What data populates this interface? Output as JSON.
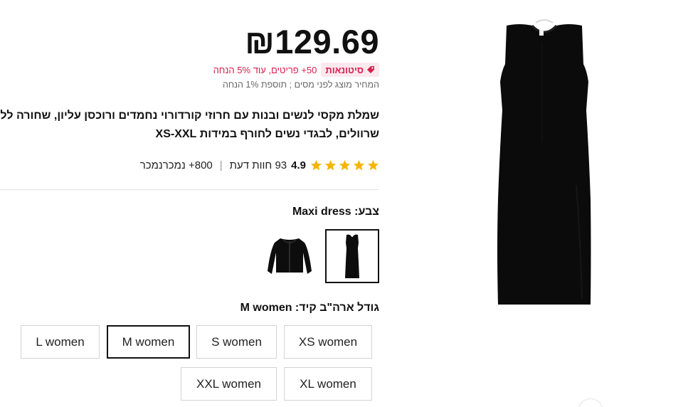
{
  "product": {
    "price": "₪129.69",
    "wholesale_badge": "סיטונאות",
    "promo_text": "50+ פריטים, עוד 5% הנחה",
    "tax_note": "המחיר מוצג לפני מסים ; תוספת 1% הנחה",
    "title": "שמלת מקסי לנשים ובנות עם חרוזי קורדורוי נחמדים ורוכסן עליון, שחורה ללא שרוולים, לבגדי נשים לחורף במידות XS-XXL"
  },
  "rating": {
    "value": "4.9",
    "stars": 5,
    "reviews": "93 חוות דעת",
    "sold": "800+ נמכרנמכר"
  },
  "color": {
    "label": "צבע: Maxi dress",
    "options": [
      "Maxi dress",
      "Jacket"
    ],
    "selected": "Maxi dress"
  },
  "size": {
    "label": "גודל ארה\"ב קיד: M women",
    "options": [
      "XS women",
      "S women",
      "M women",
      "L women",
      "XL women",
      "XXL women"
    ],
    "selected": "M women"
  },
  "colors": {
    "accent": "#d8204f",
    "badge_bg": "#fde8ee",
    "star": "#f5b500",
    "text": "#111111"
  },
  "icons": {
    "badge": "tag-icon",
    "rating": "star-icon"
  }
}
